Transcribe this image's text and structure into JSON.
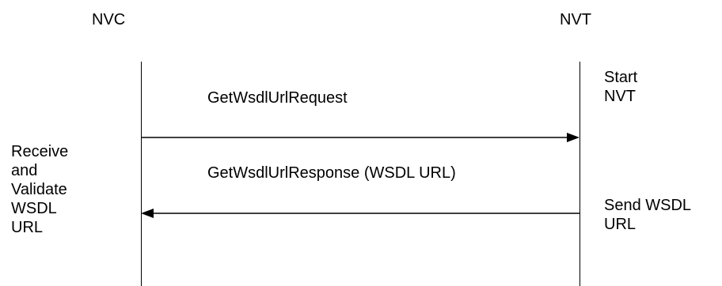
{
  "participants": {
    "client": "NVC",
    "device": "NVT"
  },
  "messages": {
    "request": "GetWsdlUrlRequest",
    "response": "GetWsdlUrlResponse (WSDL URL)"
  },
  "notes": {
    "device_start": [
      "Start",
      "NVT"
    ],
    "device_send": [
      "Send WSDL",
      "URL"
    ],
    "client_receive": [
      "Receive",
      "and",
      "Validate",
      "WSDL",
      "URL"
    ]
  },
  "colors": {
    "line": "#000000",
    "background": "#ffffff"
  }
}
